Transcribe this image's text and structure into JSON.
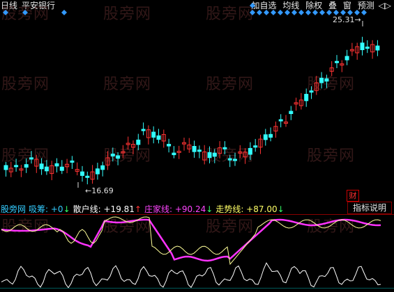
{
  "topbar": {
    "period": "日线",
    "stock_name": "平安银行",
    "buttons": [
      "加自选",
      "均线",
      "除权",
      "叠",
      "窗",
      "预测"
    ],
    "scroll_arrows": [
      "◁",
      "▷"
    ]
  },
  "price_labels": {
    "high": "25.31",
    "high_arrow": "→",
    "low_arrow": "←",
    "low": "16.69"
  },
  "badge_cai": "财",
  "indicator_button": "指标说明",
  "indicator_row": [
    {
      "label": "股旁网",
      "color": "#33ccff"
    },
    {
      "label": "吸筹: +0",
      "color": "#33ccff",
      "arrow": "↓"
    },
    {
      "label": "散户线: +19.81",
      "color": "#ffffff",
      "arrow": "↑"
    },
    {
      "label": "庄家线: +90.24",
      "color": "#ff44ff",
      "arrow": "↓"
    },
    {
      "label": "走势线: +87.00",
      "color": "#ffff66",
      "arrow": "↓"
    }
  ],
  "watermark": "股旁网",
  "colors": {
    "bg": "#000000",
    "up": "#ff3333",
    "down": "#33ffff",
    "diamond": "#3399ff",
    "magenta_line": "#ff33ff",
    "yellow_line": "#ffff99",
    "white_line": "#ffffff",
    "divider": "#8a0000"
  }
}
